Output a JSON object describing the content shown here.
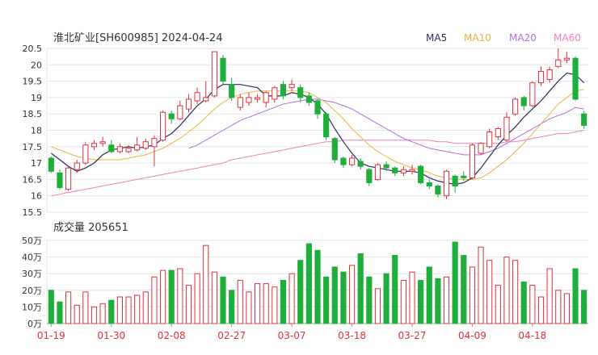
{
  "header": {
    "title": "淮北矿业[SH600985] 2024-04-24",
    "volume_label": "成交量 205651"
  },
  "legend": [
    {
      "name": "MA5",
      "color": "#2f2f5f"
    },
    {
      "name": "MA10",
      "color": "#f0b040"
    },
    {
      "name": "MA20",
      "color": "#b070e0"
    },
    {
      "name": "MA60",
      "color": "#f07fbf"
    }
  ],
  "colors": {
    "up": "#e0323c",
    "down": "#1fae3c",
    "grid": "#e6e6e6",
    "axis_text": "#333333",
    "date_text": "#e0323c"
  },
  "chart_data": [
    {
      "type": "candlestick",
      "title": "淮北矿业[SH600985] 2024-04-24",
      "ylim": [
        15.5,
        20.5
      ],
      "y_ticks": [
        "20.5",
        "20",
        "19.5",
        "19",
        "18.5",
        "18",
        "17.5",
        "17",
        "16.5",
        "16",
        "15.5"
      ],
      "x_ticks": [
        "01-19",
        "01-30",
        "02-08",
        "02-27",
        "03-07",
        "03-18",
        "03-27",
        "04-09",
        "04-18"
      ],
      "x_tick_index": [
        0,
        7,
        14,
        21,
        28,
        35,
        42,
        49,
        56
      ],
      "candles": [
        [
          17.15,
          16.75,
          17.2,
          16.7
        ],
        [
          16.7,
          16.25,
          16.8,
          16.2
        ],
        [
          16.2,
          16.85,
          16.9,
          16.15
        ],
        [
          16.8,
          17.0,
          17.1,
          16.7
        ],
        [
          17.0,
          17.55,
          17.65,
          16.95
        ],
        [
          17.5,
          17.6,
          17.7,
          17.4
        ],
        [
          17.6,
          17.65,
          17.8,
          17.5
        ],
        [
          17.55,
          17.35,
          17.7,
          17.3
        ],
        [
          17.35,
          17.5,
          17.6,
          17.3
        ],
        [
          17.35,
          17.45,
          17.55,
          17.3
        ],
        [
          17.4,
          17.55,
          17.8,
          17.35
        ],
        [
          17.45,
          17.65,
          17.75,
          17.4
        ],
        [
          17.5,
          17.75,
          17.85,
          16.9
        ],
        [
          17.7,
          18.55,
          18.6,
          17.65
        ],
        [
          18.5,
          18.35,
          18.6,
          18.2
        ],
        [
          18.35,
          18.75,
          18.9,
          18.3
        ],
        [
          18.65,
          18.95,
          19.1,
          18.55
        ],
        [
          18.9,
          19.15,
          19.3,
          18.8
        ],
        [
          18.9,
          19.0,
          19.5,
          18.85
        ],
        [
          19.05,
          20.4,
          20.4,
          19.0
        ],
        [
          20.2,
          19.5,
          20.3,
          19.4
        ],
        [
          19.4,
          19.0,
          19.6,
          18.9
        ],
        [
          18.7,
          19.0,
          19.1,
          18.6
        ],
        [
          18.85,
          19.0,
          19.15,
          18.75
        ],
        [
          18.95,
          19.0,
          19.1,
          18.85
        ],
        [
          18.85,
          19.15,
          19.2,
          18.7
        ],
        [
          18.95,
          19.3,
          19.35,
          18.85
        ],
        [
          19.4,
          19.05,
          19.5,
          18.95
        ],
        [
          19.3,
          19.4,
          19.55,
          19.2
        ],
        [
          19.3,
          19.0,
          19.4,
          18.85
        ],
        [
          19.05,
          18.85,
          19.15,
          18.75
        ],
        [
          18.9,
          18.5,
          18.95,
          18.35
        ],
        [
          18.5,
          17.8,
          18.55,
          17.7
        ],
        [
          17.75,
          17.1,
          17.8,
          17.0
        ],
        [
          17.15,
          16.95,
          17.2,
          16.85
        ],
        [
          16.95,
          17.15,
          17.25,
          16.9
        ],
        [
          17.05,
          16.9,
          17.15,
          16.8
        ],
        [
          16.8,
          16.4,
          16.85,
          16.3
        ],
        [
          16.5,
          16.95,
          17.0,
          16.45
        ],
        [
          16.95,
          16.85,
          17.05,
          16.75
        ],
        [
          16.85,
          16.7,
          16.9,
          16.6
        ],
        [
          16.7,
          16.8,
          16.9,
          16.6
        ],
        [
          16.75,
          16.8,
          16.95,
          16.65
        ],
        [
          16.9,
          16.4,
          16.95,
          16.35
        ],
        [
          16.4,
          16.3,
          16.5,
          16.2
        ],
        [
          16.3,
          16.05,
          16.35,
          15.95
        ],
        [
          16.0,
          16.75,
          16.8,
          15.9
        ],
        [
          16.6,
          16.3,
          16.65,
          16.1
        ],
        [
          16.6,
          16.55,
          16.75,
          16.45
        ],
        [
          16.55,
          17.55,
          17.6,
          16.5
        ],
        [
          17.3,
          17.6,
          17.65,
          17.25
        ],
        [
          17.5,
          17.95,
          18.05,
          17.45
        ],
        [
          17.8,
          18.05,
          18.1,
          17.7
        ],
        [
          17.7,
          18.4,
          18.55,
          17.65
        ],
        [
          18.5,
          18.95,
          19.0,
          18.45
        ],
        [
          19.0,
          18.75,
          19.05,
          18.6
        ],
        [
          18.75,
          19.45,
          19.5,
          18.7
        ],
        [
          19.45,
          19.8,
          19.95,
          19.35
        ],
        [
          19.55,
          19.85,
          19.95,
          19.45
        ],
        [
          19.95,
          20.15,
          20.5,
          19.9
        ],
        [
          20.15,
          20.2,
          20.4,
          20.05
        ],
        [
          20.2,
          18.95,
          20.25,
          18.9
        ],
        [
          18.5,
          18.15,
          18.6,
          18.05
        ]
      ],
      "ma": {
        "MA5": [
          17.3,
          17.1,
          16.9,
          16.75,
          16.85,
          17.0,
          17.25,
          17.4,
          17.45,
          17.5,
          17.45,
          17.5,
          17.55,
          17.75,
          17.9,
          18.15,
          18.45,
          18.75,
          18.95,
          19.25,
          19.4,
          19.4,
          19.4,
          19.35,
          19.3,
          19.05,
          19.05,
          19.05,
          19.15,
          19.1,
          19.0,
          18.8,
          18.5,
          18.05,
          17.65,
          17.3,
          17.0,
          16.9,
          16.85,
          16.8,
          16.75,
          16.75,
          16.75,
          16.7,
          16.55,
          16.45,
          16.4,
          16.35,
          16.4,
          16.55,
          16.85,
          17.2,
          17.55,
          17.85,
          18.1,
          18.4,
          18.65,
          18.9,
          19.2,
          19.5,
          19.75,
          19.7,
          19.45
        ],
        "MA10": [
          17.5,
          17.4,
          17.3,
          17.2,
          17.15,
          17.1,
          17.1,
          17.1,
          17.1,
          17.15,
          17.2,
          17.25,
          17.35,
          17.45,
          17.6,
          17.75,
          17.95,
          18.15,
          18.4,
          18.65,
          18.85,
          19.0,
          19.1,
          19.15,
          19.2,
          19.2,
          19.2,
          19.2,
          19.2,
          19.2,
          19.15,
          19.0,
          18.85,
          18.6,
          18.35,
          18.05,
          17.8,
          17.55,
          17.35,
          17.2,
          17.05,
          16.95,
          16.85,
          16.8,
          16.7,
          16.6,
          16.55,
          16.5,
          16.5,
          16.5,
          16.55,
          16.7,
          16.9,
          17.1,
          17.35,
          17.6,
          17.9,
          18.2,
          18.5,
          18.8,
          19.0,
          19.2,
          19.25
        ],
        "MA20": [
          null,
          null,
          null,
          null,
          null,
          null,
          null,
          null,
          null,
          null,
          null,
          null,
          null,
          null,
          null,
          null,
          17.45,
          17.55,
          17.7,
          17.85,
          18.0,
          18.15,
          18.3,
          18.4,
          18.5,
          18.6,
          18.7,
          18.8,
          18.85,
          18.9,
          18.95,
          18.95,
          18.9,
          18.85,
          18.75,
          18.65,
          18.5,
          18.35,
          18.2,
          18.05,
          17.9,
          17.75,
          17.65,
          17.55,
          17.45,
          17.4,
          17.35,
          17.3,
          17.25,
          17.25,
          17.25,
          17.35,
          17.45,
          17.6,
          17.75,
          17.9,
          18.05,
          18.2,
          18.35,
          18.45,
          18.55,
          18.7,
          18.65
        ],
        "MA60": [
          16.0,
          16.05,
          16.1,
          16.15,
          16.2,
          16.25,
          16.3,
          16.35,
          16.4,
          16.45,
          16.5,
          16.55,
          16.6,
          16.65,
          16.7,
          16.75,
          16.8,
          16.85,
          16.9,
          16.95,
          17.0,
          17.1,
          17.15,
          17.2,
          17.25,
          17.3,
          17.35,
          17.4,
          17.45,
          17.5,
          17.55,
          17.6,
          17.65,
          17.65,
          17.7,
          17.7,
          17.7,
          17.7,
          17.7,
          17.7,
          17.7,
          17.7,
          17.7,
          17.7,
          17.7,
          17.65,
          17.65,
          17.6,
          17.6,
          17.6,
          17.6,
          17.6,
          17.6,
          17.65,
          17.65,
          17.7,
          17.75,
          17.8,
          17.85,
          17.9,
          17.9,
          17.95,
          18.0
        ]
      }
    },
    {
      "type": "bar",
      "title": "成交量 205651",
      "ylim": [
        0,
        50
      ],
      "y_ticks": [
        "50万",
        "40万",
        "30万",
        "20万",
        "10万",
        "0万"
      ],
      "values": [
        20,
        13,
        19,
        11,
        19,
        10,
        12,
        14,
        16,
        16,
        17,
        19,
        28,
        32,
        32,
        33,
        23,
        30,
        47,
        31,
        28,
        20,
        26,
        19,
        24,
        24,
        22,
        26,
        30,
        38,
        48,
        44,
        28,
        34,
        31,
        35,
        42,
        28,
        21,
        30,
        41,
        26,
        31,
        26,
        34,
        27,
        28,
        49,
        41,
        34,
        46,
        38,
        23,
        40,
        38,
        25,
        23,
        16,
        33,
        20,
        18,
        33,
        20
      ]
    }
  ]
}
